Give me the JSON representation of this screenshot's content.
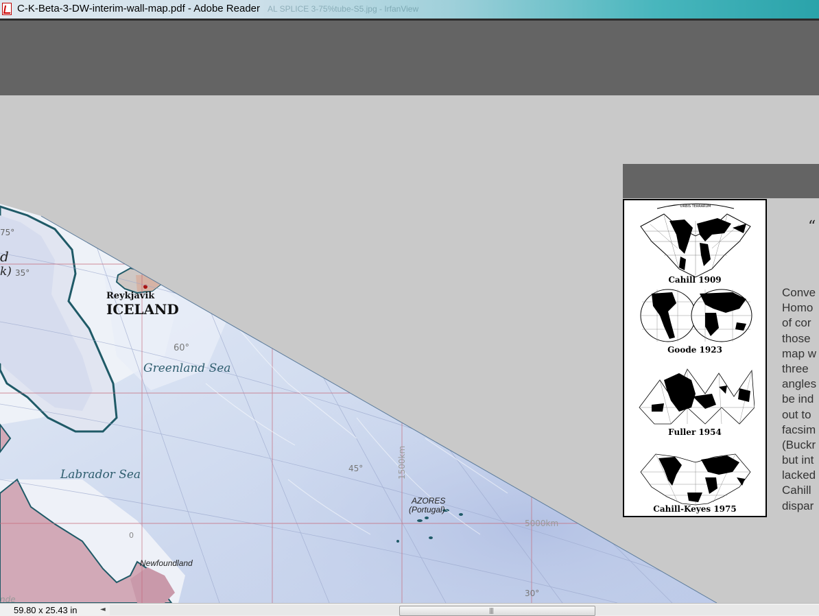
{
  "window": {
    "title": "C-K-Beta-3-DW-interim-wall-map.pdf - Adobe Reader",
    "background_window_title": "AL SPLICE 3-75%tube-S5.jpg - IrfanView",
    "icon": "pdf-file-icon"
  },
  "map": {
    "labels": {
      "reykjavik": "Reykjavik",
      "iceland": "ICELAND",
      "greenland_sea": "Greenland Sea",
      "labrador_sea": "Labrador Sea",
      "azores": "AZORES",
      "portugal": "(Portugal)",
      "newfoundland": "Newfoundland",
      "partial_d": "d",
      "partial_k": "k)",
      "partial_nde": "nde"
    },
    "degree_labels": {
      "d75": "75°",
      "d35": "35°",
      "d60": "60°",
      "d45": "45°",
      "d30": "30°",
      "d0": "0"
    },
    "scale_labels": {
      "vertical": "1500km",
      "horizontal": "5000km"
    },
    "colors": {
      "ocean_light": "#e4ecf6",
      "ocean_deep": "#b9c9e6",
      "land_greenland": "#e2e6f2",
      "land_pink": "#d2a9b7",
      "coast": "#1f5a67",
      "grid_red": "#c66a7a",
      "grid_blue": "#9aa7cc"
    }
  },
  "panel": {
    "captions": {
      "cahill_1909": "Cahill 1909",
      "goode_1923": "Goode 1923",
      "fuller_1954": "Fuller 1954",
      "cahill_keyes_1975": "Cahill-Keyes 1975",
      "orbis": "ORBIS TERRARUM"
    },
    "quote_mark": "“",
    "text_lines": [
      "Conve",
      "Homo",
      "of  cor",
      "those",
      "map w",
      "three",
      "angles",
      "be ind",
      "out to",
      "facsim",
      "(Buckr",
      "but int",
      "lacked",
      "Cahill",
      "dispar"
    ]
  },
  "statusbar": {
    "page_size": "59.80 x 25.43 in",
    "scroll_left_arrow": "◄",
    "grip": "|||"
  }
}
